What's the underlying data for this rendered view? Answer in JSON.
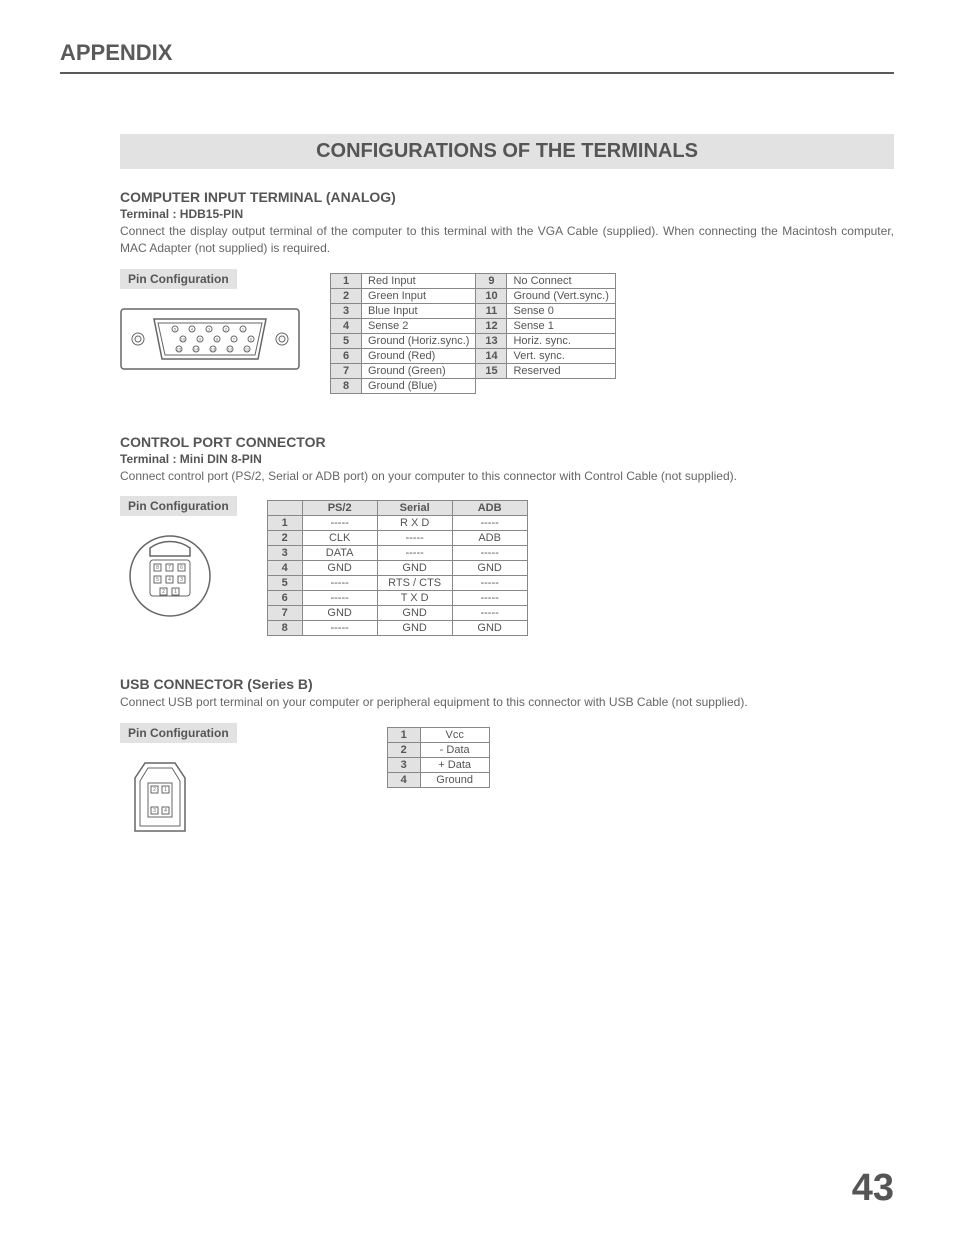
{
  "header": "APPENDIX",
  "section_title": "CONFIGURATIONS OF THE TERMINALS",
  "page_number": "43",
  "pin_config_label": "Pin Configuration",
  "section1": {
    "title": "COMPUTER INPUT TERMINAL (ANALOG)",
    "terminal": "Terminal : HDB15-PIN",
    "desc": "Connect the display output terminal of the computer to this terminal with the VGA Cable (supplied).  When connecting the Macintosh computer, MAC Adapter (not supplied) is required.",
    "left_pins": [
      {
        "n": "1",
        "v": "Red Input"
      },
      {
        "n": "2",
        "v": "Green Input"
      },
      {
        "n": "3",
        "v": "Blue Input"
      },
      {
        "n": "4",
        "v": "Sense 2"
      },
      {
        "n": "5",
        "v": "Ground (Horiz.sync.)"
      },
      {
        "n": "6",
        "v": "Ground (Red)"
      },
      {
        "n": "7",
        "v": "Ground (Green)"
      },
      {
        "n": "8",
        "v": "Ground (Blue)"
      }
    ],
    "right_pins": [
      {
        "n": "9",
        "v": "No Connect"
      },
      {
        "n": "10",
        "v": "Ground (Vert.sync.)"
      },
      {
        "n": "11",
        "v": "Sense 0"
      },
      {
        "n": "12",
        "v": "Sense 1"
      },
      {
        "n": "13",
        "v": "Horiz. sync."
      },
      {
        "n": "14",
        "v": "Vert. sync."
      },
      {
        "n": "15",
        "v": "Reserved"
      }
    ]
  },
  "section2": {
    "title": "CONTROL PORT CONNECTOR",
    "terminal": "Terminal : Mini DIN 8-PIN",
    "desc": "Connect control port (PS/2, Serial or ADB port) on your computer to this connector with Control Cable (not supplied).",
    "headers": [
      "PS/2",
      "Serial",
      "ADB"
    ],
    "rows": [
      {
        "n": "1",
        "c": [
          "-----",
          "R X D",
          "-----"
        ]
      },
      {
        "n": "2",
        "c": [
          "CLK",
          "-----",
          "ADB"
        ]
      },
      {
        "n": "3",
        "c": [
          "DATA",
          "-----",
          "-----"
        ]
      },
      {
        "n": "4",
        "c": [
          "GND",
          "GND",
          "GND"
        ]
      },
      {
        "n": "5",
        "c": [
          "-----",
          "RTS / CTS",
          "-----"
        ]
      },
      {
        "n": "6",
        "c": [
          "-----",
          "T X D",
          "-----"
        ]
      },
      {
        "n": "7",
        "c": [
          "GND",
          "GND",
          "-----"
        ]
      },
      {
        "n": "8",
        "c": [
          "-----",
          "GND",
          "GND"
        ]
      }
    ]
  },
  "section3": {
    "title": "USB CONNECTOR (Series B)",
    "desc": "Connect USB port terminal on your computer or peripheral equipment to this connector with USB Cable (not supplied).",
    "rows": [
      {
        "n": "1",
        "v": "Vcc"
      },
      {
        "n": "2",
        "v": "- Data"
      },
      {
        "n": "3",
        "v": "+ Data"
      },
      {
        "n": "4",
        "v": "Ground"
      }
    ]
  }
}
